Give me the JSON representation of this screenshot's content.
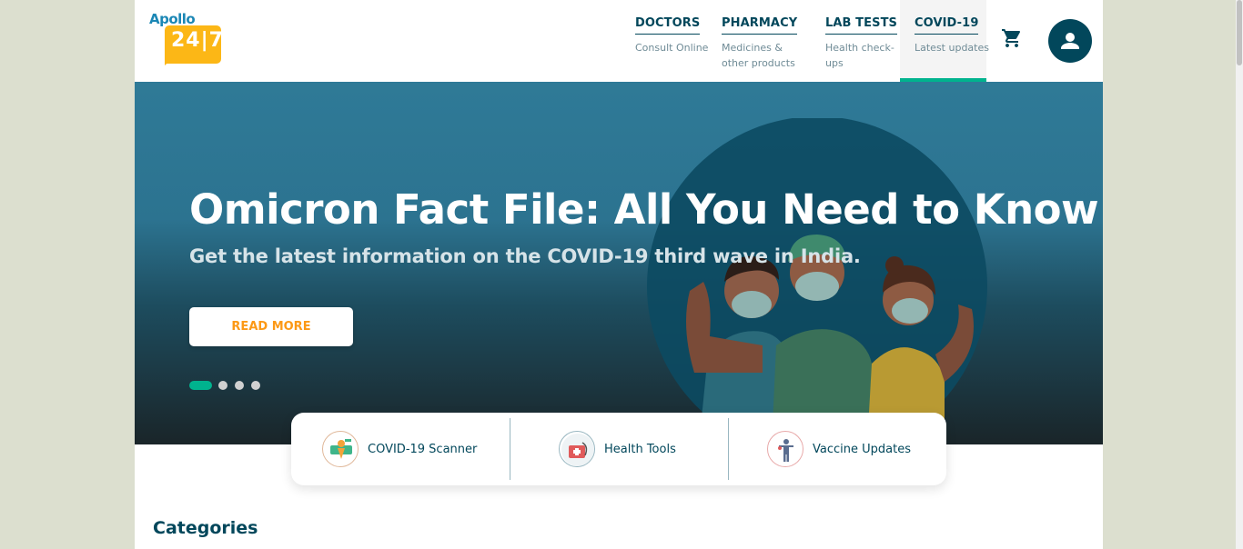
{
  "logo": {
    "top_text": "Apollo",
    "badge_text": "24|7"
  },
  "nav": [
    {
      "title": "DOCTORS",
      "sub": "Consult Online"
    },
    {
      "title": "PHARMACY",
      "sub": "Medicines & other products"
    },
    {
      "title": "LAB TESTS",
      "sub": "Health check-ups"
    },
    {
      "title": "COVID-19",
      "sub": "Latest updates"
    }
  ],
  "icons": {
    "cart": "cart-icon",
    "user": "user-icon"
  },
  "hero": {
    "title": "Omicron Fact File: All You Need to Know",
    "subtitle": "Get the latest information on the COVID-19 third wave in India.",
    "cta": "READ MORE",
    "slides": 4,
    "active_slide": 1
  },
  "quick_links": [
    {
      "label": "COVID-19 Scanner",
      "icon": "scanner-icon"
    },
    {
      "label": "Health Tools",
      "icon": "health-tools-icon"
    },
    {
      "label": "Vaccine Updates",
      "icon": "vaccine-icon"
    }
  ],
  "sections": {
    "categories": "Categories"
  },
  "colors": {
    "primary": "#02475b",
    "accent": "#fc9916",
    "green": "#00b38e",
    "logo_yellow": "#fcb716",
    "logo_blue": "#1b87b5"
  }
}
